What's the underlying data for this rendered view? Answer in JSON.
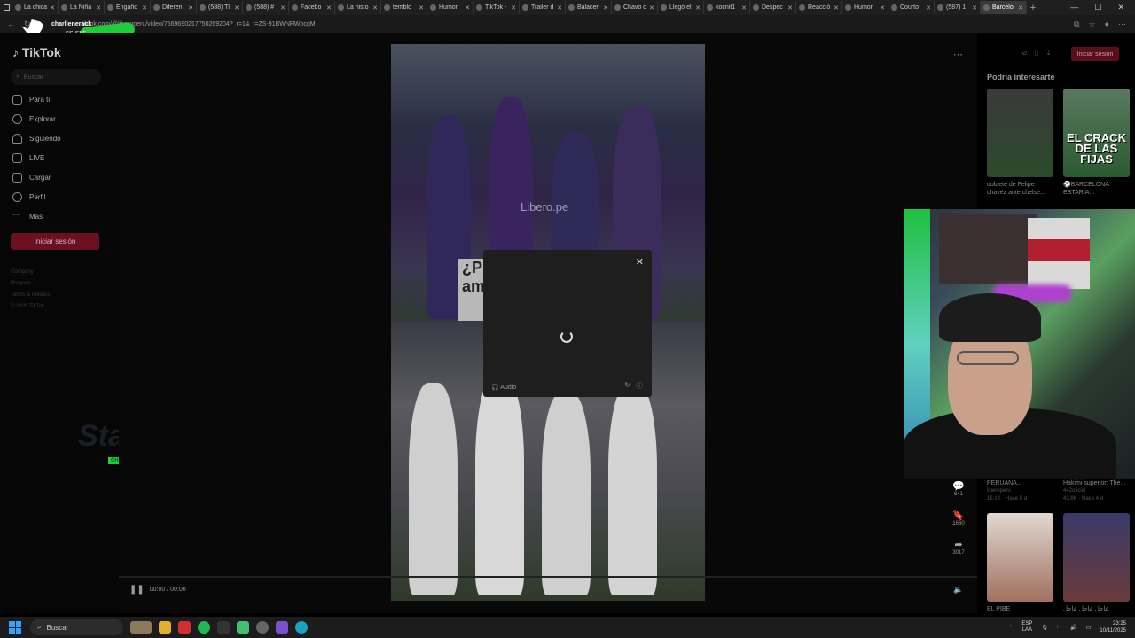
{
  "browser": {
    "tabs": [
      {
        "label": "La chica"
      },
      {
        "label": "La Niña"
      },
      {
        "label": "Engaño"
      },
      {
        "label": "Diferen"
      },
      {
        "label": "(588) Tl"
      },
      {
        "label": "(588) #"
      },
      {
        "label": "Facebo"
      },
      {
        "label": "La histo"
      },
      {
        "label": "temblo"
      },
      {
        "label": "Humor"
      },
      {
        "label": "TikTok -"
      },
      {
        "label": "Trailer d"
      },
      {
        "label": "Balacer"
      },
      {
        "label": "Chavo c"
      },
      {
        "label": "Llegó el"
      },
      {
        "label": "kocnit1"
      },
      {
        "label": "Despec"
      },
      {
        "label": "Reacció"
      },
      {
        "label": "Humor"
      },
      {
        "label": "Courto"
      },
      {
        "label": "(587) 1"
      },
      {
        "label": "Barcelo"
      }
    ],
    "active_tab_index": 21,
    "url": "tiktok.com/@liberoperu/video/7569690217750269204?_r=1&_t=ZS-91BWNRWbcgM"
  },
  "overlay_twitter": {
    "name": "charlienerack",
    "sub": "SIGUEME"
  },
  "sidebar": {
    "logo": "TikTok",
    "search_placeholder": "Buscar",
    "items": [
      {
        "label": "Para ti",
        "icon": "home-icon"
      },
      {
        "label": "Explorar",
        "icon": "compass-icon"
      },
      {
        "label": "Siguiendo",
        "icon": "user-icon"
      },
      {
        "label": "LIVE",
        "icon": "live-icon"
      },
      {
        "label": "Cargar",
        "icon": "plus-icon"
      },
      {
        "label": "Perfil",
        "icon": "profile-icon"
      },
      {
        "label": "Más",
        "icon": "more-icon"
      }
    ],
    "login_label": "Iniciar sesión",
    "footer": [
      "Company",
      "Program",
      "Terms & Policies",
      "© 2025 TikTok"
    ],
    "stake_label": "Stake",
    "chales_label": "CHALES"
  },
  "video": {
    "watermark": "Libero.pe",
    "sign_text": "¿P am",
    "time": "00:00 / 00:00"
  },
  "modal": {
    "audio_label": "Audio"
  },
  "actions": {
    "comments": "641",
    "saves": "1660",
    "shares": "3017"
  },
  "right_panel": {
    "login_label": "Iniciar sesión",
    "title": "Podría interesarte",
    "cards": [
      {
        "title": "doblete de Felipe chavez ante chelse...",
        "meta": ""
      },
      {
        "title": "⚽BARCELONA ESTARÍA...",
        "meta": "",
        "overlay": "EL CRACK DE LAS FIJAS"
      },
      {
        "title": "PERUANA...",
        "meta": "liberoperu",
        "stats": "16.1K · Hace 5 d"
      },
      {
        "title": "Hakimi superior: The...",
        "meta": "442oficial",
        "stats": "43.8K · Hace 4 d"
      },
      {
        "title": "EL PIBE",
        "meta": ""
      },
      {
        "title": "عاجل عاجل عاجل",
        "meta": ""
      }
    ]
  },
  "taskbar": {
    "search": "Buscar",
    "lang": "ESP",
    "lang_sub": "LAA",
    "time": "23:25",
    "date": "10/11/2025"
  },
  "colors": {
    "accent": "#fe2c55",
    "stream_green": "#1ccf3a",
    "windows_blue": "#3aa0ff"
  }
}
